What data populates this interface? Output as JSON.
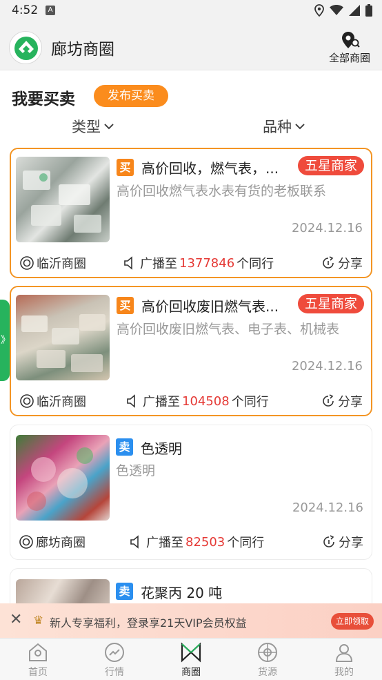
{
  "status_bar": {
    "time": "4:52",
    "a_label": "A"
  },
  "header": {
    "title": "廊坊商圈",
    "all_circles_label": "全部商圈"
  },
  "section": {
    "title": "我要买卖",
    "publish_label": "发布买卖"
  },
  "filters": {
    "type_label": "类型",
    "variety_label": "品种"
  },
  "side_tab": {
    "label": "》"
  },
  "listings": [
    {
      "badge": "买",
      "title": "高价回收，燃气表，...",
      "merchant_tag": "五星商家",
      "description": "高价回收燃气表水表有货的老板联系",
      "date": "2024.12.16",
      "location": "临沂商圈",
      "broadcast_prefix": "广播至",
      "broadcast_count": "1377846",
      "broadcast_suffix": "个同行",
      "share": "分享"
    },
    {
      "badge": "买",
      "title": "高价回收废旧燃气表...",
      "merchant_tag": "五星商家",
      "description": "高价回收废旧燃气表、电子表、机械表",
      "date": "2024.12.16",
      "location": "临沂商圈",
      "broadcast_prefix": "广播至",
      "broadcast_count": "104508",
      "broadcast_suffix": "个同行",
      "share": "分享"
    },
    {
      "badge": "卖",
      "title": "色透明",
      "description": "色透明",
      "date": "2024.12.16",
      "location": "廊坊商圈",
      "broadcast_prefix": "广播至",
      "broadcast_count": "82503",
      "broadcast_suffix": "个同行",
      "share": "分享"
    },
    {
      "badge": "卖",
      "title": "花聚丙 20 吨"
    }
  ],
  "promo": {
    "close": "✕",
    "crown": "♛",
    "text": "新人专享福利，登录享21天VIP会员权益",
    "button": "立即领取"
  },
  "bottom_nav": [
    {
      "label": "首页",
      "icon": "home-icon"
    },
    {
      "label": "行情",
      "icon": "trend-icon"
    },
    {
      "label": "商圈",
      "icon": "circle-logo-icon",
      "active": true
    },
    {
      "label": "货源",
      "icon": "compass-icon"
    },
    {
      "label": "我的",
      "icon": "profile-icon"
    }
  ],
  "colors": {
    "accent_orange": "#fb8c1d",
    "featured_border": "#f39524",
    "merchant_red": "#ef4b3c",
    "sell_blue": "#2b8fef",
    "brand_green": "#27b35d",
    "count_red": "#e53935"
  }
}
